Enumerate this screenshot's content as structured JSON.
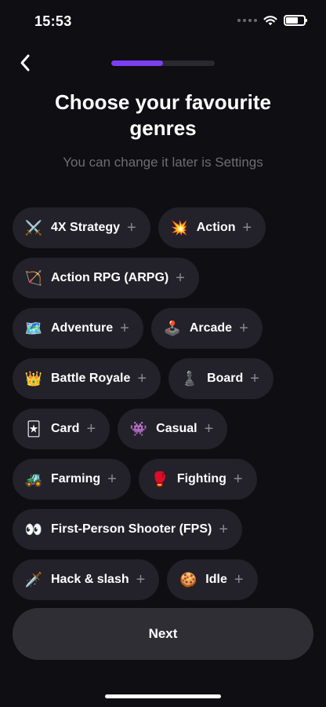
{
  "status_bar": {
    "time": "15:53",
    "battery_level": 0.7
  },
  "header": {
    "back_icon": "chevron-left-icon",
    "progress": 0.5,
    "progress_color": "#7b3ff2"
  },
  "title": "Choose your favourite genres",
  "subtitle": "You can change it later is Settings",
  "genres": [
    {
      "emoji": "⚔️",
      "icon": "crossed-swords-icon",
      "label": "4X Strategy"
    },
    {
      "emoji": "💥",
      "icon": "collision-icon",
      "label": "Action"
    },
    {
      "emoji": "🏹",
      "icon": "bow-and-arrow-icon",
      "label": "Action RPG (ARPG)"
    },
    {
      "emoji": "🗺️",
      "icon": "world-map-icon",
      "label": "Adventure"
    },
    {
      "emoji": "🕹️",
      "icon": "joystick-icon",
      "label": "Arcade"
    },
    {
      "emoji": "👑",
      "icon": "crown-icon",
      "label": "Battle Royale"
    },
    {
      "emoji": "♟️",
      "icon": "chess-pawn-icon",
      "label": "Board"
    },
    {
      "emoji": "🃏",
      "icon": "playing-card-icon",
      "label": "Card"
    },
    {
      "emoji": "👾",
      "icon": "space-invader-icon",
      "label": "Casual"
    },
    {
      "emoji": "🚜",
      "icon": "tractor-icon",
      "label": "Farming"
    },
    {
      "emoji": "🥊",
      "icon": "boxing-glove-icon",
      "label": "Fighting"
    },
    {
      "emoji": "👀",
      "icon": "eyes-icon",
      "label": "First-Person Shooter (FPS)"
    },
    {
      "emoji": "🗡️",
      "icon": "dagger-icon",
      "label": "Hack & slash"
    },
    {
      "emoji": "🍪",
      "icon": "cookie-icon",
      "label": "Idle"
    }
  ],
  "next_label": "Next"
}
